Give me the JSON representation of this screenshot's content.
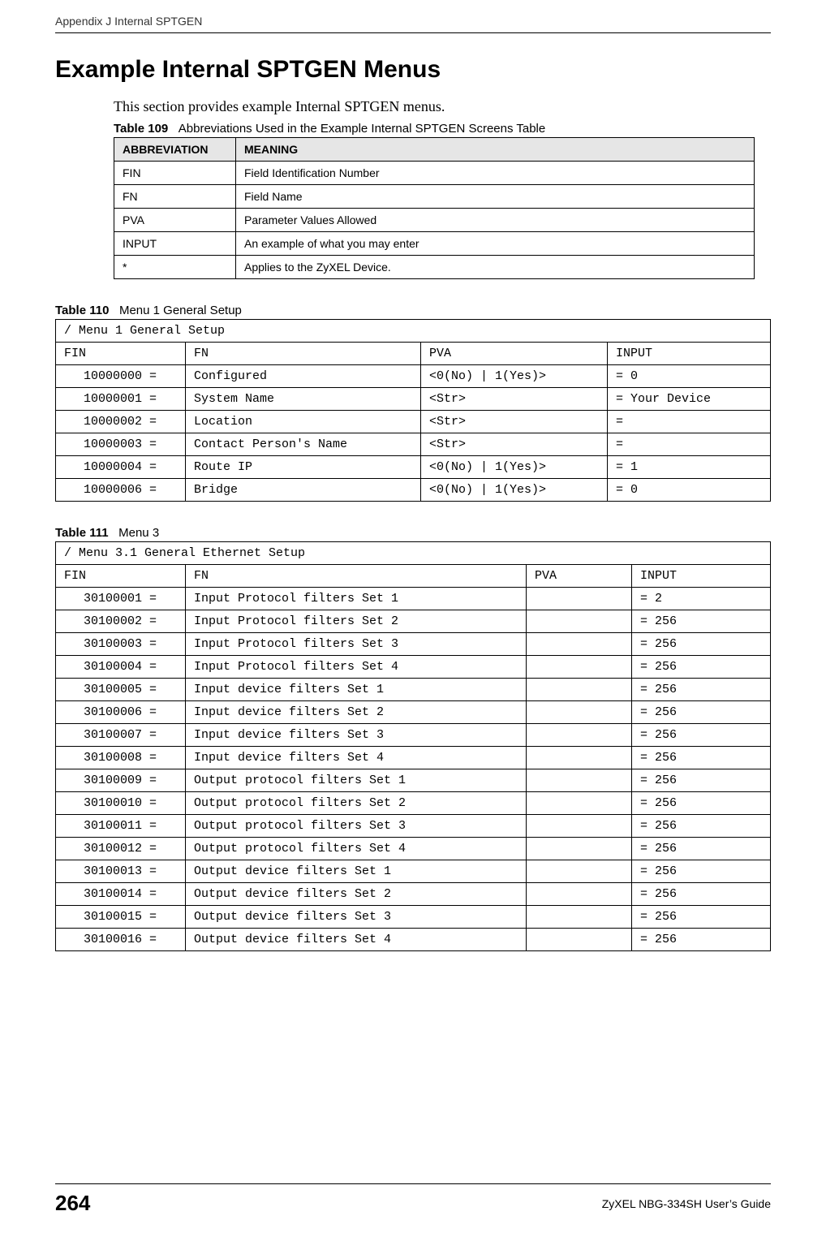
{
  "header": "Appendix J Internal SPTGEN",
  "section_title": "Example Internal SPTGEN Menus",
  "intro": "This section provides example Internal SPTGEN menus.",
  "table109": {
    "caption_prefix": "Table 109",
    "caption_text": "Abbreviations Used in the Example Internal SPTGEN Screens Table",
    "headers": [
      "ABBREVIATION",
      "MEANING"
    ],
    "rows": [
      [
        "FIN",
        "Field Identification Number"
      ],
      [
        "FN",
        "Field Name"
      ],
      [
        "PVA",
        "Parameter Values Allowed"
      ],
      [
        "INPUT",
        "An example of what you may enter"
      ],
      [
        "*",
        "Applies to the ZyXEL Device."
      ]
    ]
  },
  "table110": {
    "caption_prefix": "Table 110",
    "caption_text": "Menu 1 General Setup",
    "menu_title": "/ Menu 1 General Setup",
    "headers": [
      "FIN",
      "FN",
      "PVA",
      "INPUT"
    ],
    "rows": [
      [
        "10000000 =",
        "Configured",
        "<0(No) | 1(Yes)>",
        "= 0"
      ],
      [
        "10000001 =",
        "System Name",
        "<Str>",
        "= Your Device"
      ],
      [
        "10000002 =",
        "Location",
        "<Str>",
        "="
      ],
      [
        "10000003 =",
        "Contact Person's Name",
        "<Str>",
        "="
      ],
      [
        "10000004 =",
        "Route IP",
        "<0(No) | 1(Yes)>",
        "= 1"
      ],
      [
        "10000006 =",
        "Bridge",
        "<0(No) | 1(Yes)>",
        "= 0"
      ]
    ]
  },
  "table111": {
    "caption_prefix": "Table 111",
    "caption_text": "Menu 3",
    "menu_title": "/ Menu 3.1 General Ethernet Setup",
    "headers": [
      "FIN",
      "FN",
      "PVA",
      "INPUT"
    ],
    "rows": [
      [
        "30100001 =",
        "Input Protocol filters Set 1",
        "",
        "= 2"
      ],
      [
        "30100002 =",
        "Input Protocol filters Set 2",
        "",
        "= 256"
      ],
      [
        "30100003 =",
        "Input Protocol filters Set 3",
        "",
        "= 256"
      ],
      [
        "30100004 =",
        "Input Protocol filters Set 4",
        "",
        "= 256"
      ],
      [
        "30100005 =",
        "Input device filters Set 1",
        "",
        "= 256"
      ],
      [
        "30100006 =",
        "Input device filters Set 2",
        "",
        "= 256"
      ],
      [
        "30100007 =",
        "Input device filters Set 3",
        "",
        "= 256"
      ],
      [
        "30100008 =",
        "Input device filters Set 4",
        "",
        "= 256"
      ],
      [
        "30100009 =",
        "Output protocol filters Set 1",
        "",
        "= 256"
      ],
      [
        "30100010 =",
        "Output protocol filters Set 2",
        "",
        "= 256"
      ],
      [
        "30100011 =",
        "Output protocol filters Set 3",
        "",
        "= 256"
      ],
      [
        "30100012 =",
        "Output protocol filters Set 4",
        "",
        "= 256"
      ],
      [
        "30100013 =",
        "Output device filters Set 1",
        "",
        "= 256"
      ],
      [
        "30100014 =",
        "Output device filters Set 2",
        "",
        "= 256"
      ],
      [
        "30100015 =",
        "Output device filters Set 3",
        "",
        "= 256"
      ],
      [
        "30100016 =",
        "Output device filters Set 4",
        "",
        "= 256"
      ]
    ]
  },
  "footer": {
    "page": "264",
    "guide": "ZyXEL NBG-334SH User’s Guide"
  }
}
